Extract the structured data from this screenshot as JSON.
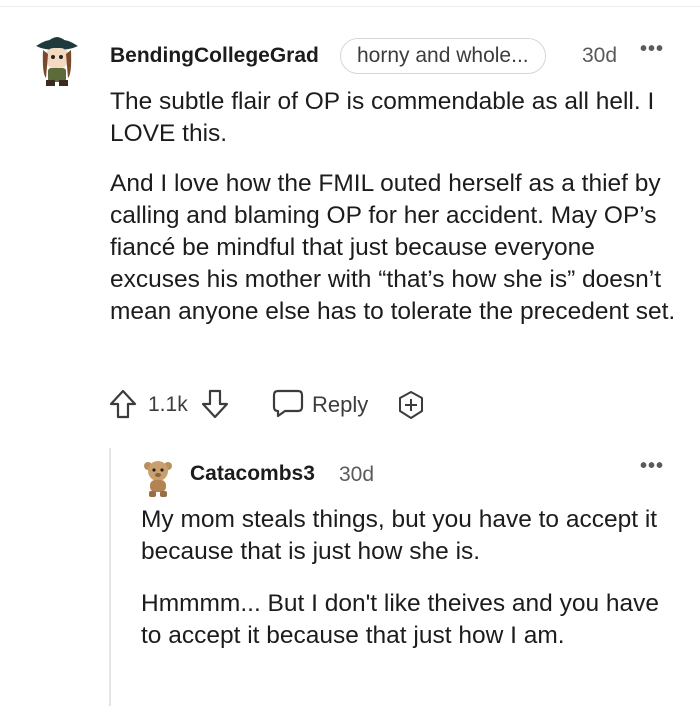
{
  "comment": {
    "author": "BendingCollegeGrad",
    "flair": "horny and whole...",
    "age": "30d",
    "more": "•••",
    "paragraphs": [
      "The subtle flair of OP is commendable as all hell. I LOVE this.",
      "And I love how the FMIL outed herself as a thief by calling and blaming OP for her accident. May OP’s fiancé be mindful that just because everyone excuses his mother with “that’s how she is” doesn’t mean anyone else has to tolerate the precedent set."
    ],
    "actions": {
      "votes": "1.1k",
      "reply": "Reply"
    }
  },
  "reply": {
    "author": "Catacombs3",
    "age": "30d",
    "more": "•••",
    "paragraphs": [
      "My mom steals things, but you have to accept it because that is just how she is.",
      "Hmmmm... But I don't like theives and you have to accept it because that just how I am."
    ]
  },
  "icons": {
    "upvote": "arrow-up-outline-icon",
    "downvote": "arrow-down-outline-icon",
    "reply": "speech-bubble-icon",
    "award": "award-plus-icon",
    "more": "ellipsis-icon"
  }
}
